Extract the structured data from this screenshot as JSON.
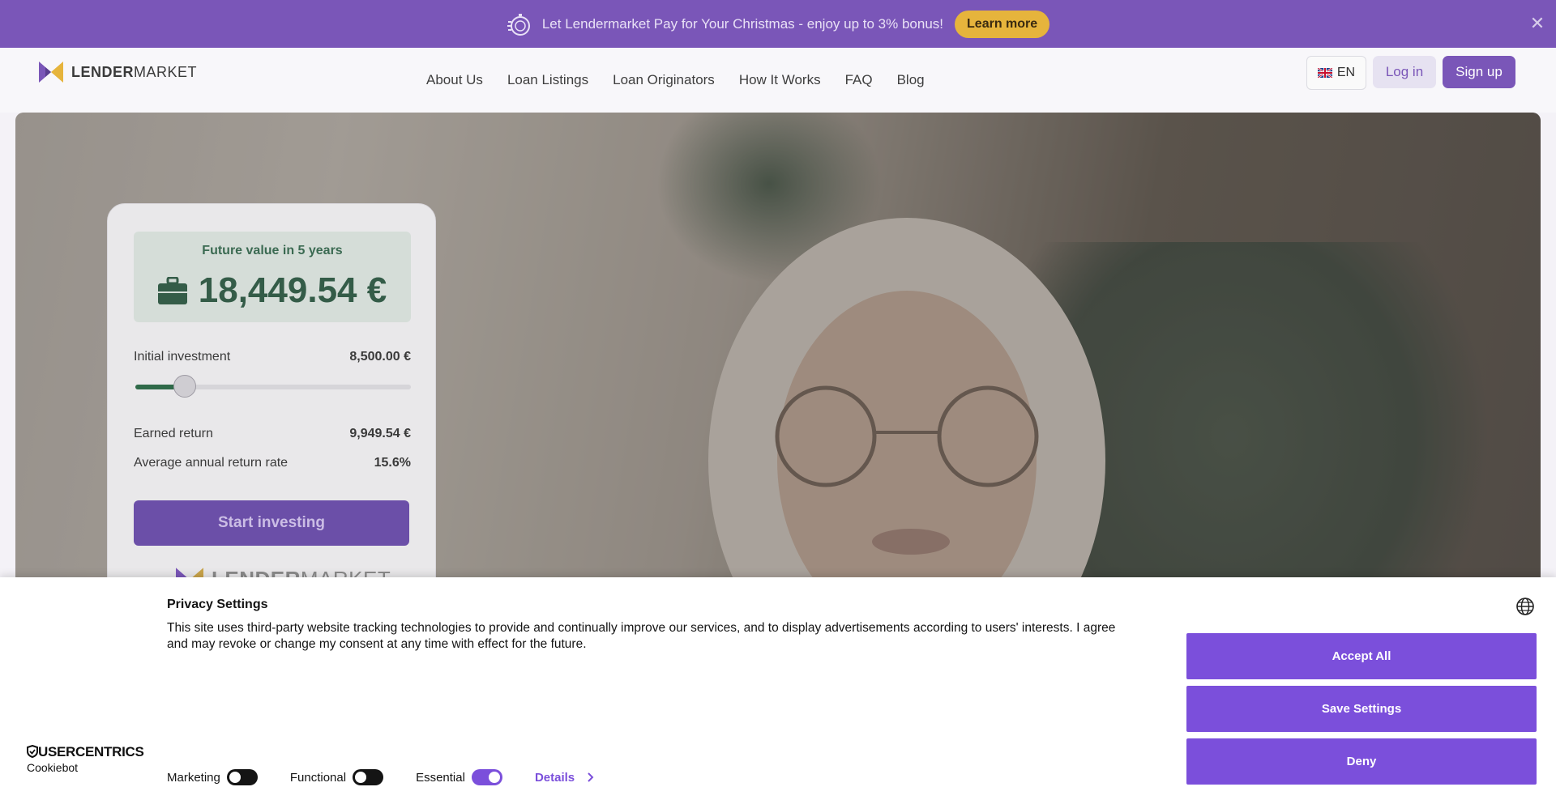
{
  "promo": {
    "text": "Let Lendermarket Pay for Your Christmas - enjoy up to 3% bonus!",
    "button": "Learn more",
    "close": "✕",
    "color": "#7a56b8",
    "button_color": "#e6b43c"
  },
  "nav": {
    "logo_bold": "LENDER",
    "logo_light": "MARKET",
    "links": [
      "About Us",
      "Loan Listings",
      "Loan Originators",
      "How It Works",
      "FAQ",
      "Blog"
    ],
    "language": "EN",
    "login": "Log in",
    "signup": "Sign up",
    "accent": "#7a56b8"
  },
  "calculator": {
    "future_label": "Future value in 5 years",
    "future_value": "18,449.54 €",
    "initial_label": "Initial investment",
    "initial_value": "8,500.00 €",
    "slider_fraction": 0.18,
    "earned_label": "Earned return",
    "earned_value": "9,949.54 €",
    "rate_label": "Average annual return rate",
    "rate_value": "15.6%",
    "start_button": "Start investing",
    "logo_bold": "LENDER",
    "logo_light": "MARKET"
  },
  "privacy": {
    "title": "Privacy Settings",
    "text": "This site uses third-party website tracking technologies to provide and continually improve our services, and to display advertisements according to users' interests. I agree and may revoke or change my consent at any time with effect for the future.",
    "accept": "Accept All",
    "save": "Save Settings",
    "deny": "Deny",
    "brand": "USERCENTRICS",
    "brand_sub": "Cookiebot",
    "toggles": [
      {
        "label": "Marketing",
        "on": false
      },
      {
        "label": "Functional",
        "on": false
      },
      {
        "label": "Essential",
        "on": true
      }
    ],
    "details": "Details",
    "button_color": "#7b4fdb"
  }
}
